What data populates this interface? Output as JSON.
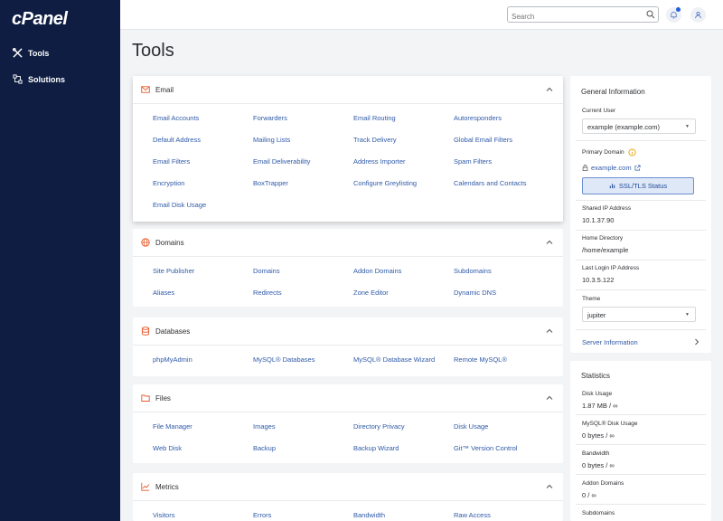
{
  "brand": {
    "logo": "cPanel"
  },
  "sidebar": {
    "items": [
      {
        "label": "Tools"
      },
      {
        "label": "Solutions"
      }
    ]
  },
  "topbar": {
    "search_placeholder": "Search"
  },
  "page": {
    "title": "Tools"
  },
  "cards": {
    "email": {
      "title": "Email",
      "links": [
        "Email Accounts",
        "Forwarders",
        "Email Routing",
        "Autoresponders",
        "Default Address",
        "Mailing Lists",
        "Track Delivery",
        "Global Email Filters",
        "Email Filters",
        "Email Deliverability",
        "Address Importer",
        "Spam Filters",
        "Encryption",
        "BoxTrapper",
        "Configure Greylisting",
        "Calendars and Contacts",
        "Email Disk Usage"
      ]
    },
    "domains": {
      "title": "Domains",
      "links": [
        "Site Publisher",
        "Domains",
        "Addon Domains",
        "Subdomains",
        "Aliases",
        "Redirects",
        "Zone Editor",
        "Dynamic DNS"
      ]
    },
    "databases": {
      "title": "Databases",
      "links": [
        "phpMyAdmin",
        "MySQL® Databases",
        "MySQL® Database Wizard",
        "Remote MySQL®"
      ]
    },
    "files": {
      "title": "Files",
      "links": [
        "File Manager",
        "Images",
        "Directory Privacy",
        "Disk Usage",
        "Web Disk",
        "Backup",
        "Backup Wizard",
        "Git™ Version Control"
      ]
    },
    "metrics": {
      "title": "Metrics",
      "links": [
        "Visitors",
        "Errors",
        "Bandwidth",
        "Raw Access"
      ]
    }
  },
  "general_info": {
    "title": "General Information",
    "current_user_label": "Current User",
    "current_user_value": "example (example.com)",
    "primary_domain_label": "Primary Domain",
    "primary_domain_value": "example.com",
    "ssl_button": "SSL/TLS Status",
    "shared_ip_label": "Shared IP Address",
    "shared_ip_value": "10.1.37.90",
    "home_dir_label": "Home Directory",
    "home_dir_value": "/home/example",
    "last_login_label": "Last Login IP Address",
    "last_login_value": "10.3.5.122",
    "theme_label": "Theme",
    "theme_value": "jupiter",
    "server_info": "Server Information"
  },
  "statistics": {
    "title": "Statistics",
    "items": [
      {
        "label": "Disk Usage",
        "value": "1.87 MB / ∞"
      },
      {
        "label": "MySQL® Disk Usage",
        "value": "0 bytes / ∞"
      },
      {
        "label": "Bandwidth",
        "value": "0 bytes / ∞"
      },
      {
        "label": "Addon Domains",
        "value": "0 / ∞"
      },
      {
        "label": "Subdomains",
        "value": ""
      }
    ]
  },
  "colors": {
    "sidebar_bg": "#0e1d41",
    "link": "#2f5aa8",
    "accent_orange": "#e8582b"
  }
}
